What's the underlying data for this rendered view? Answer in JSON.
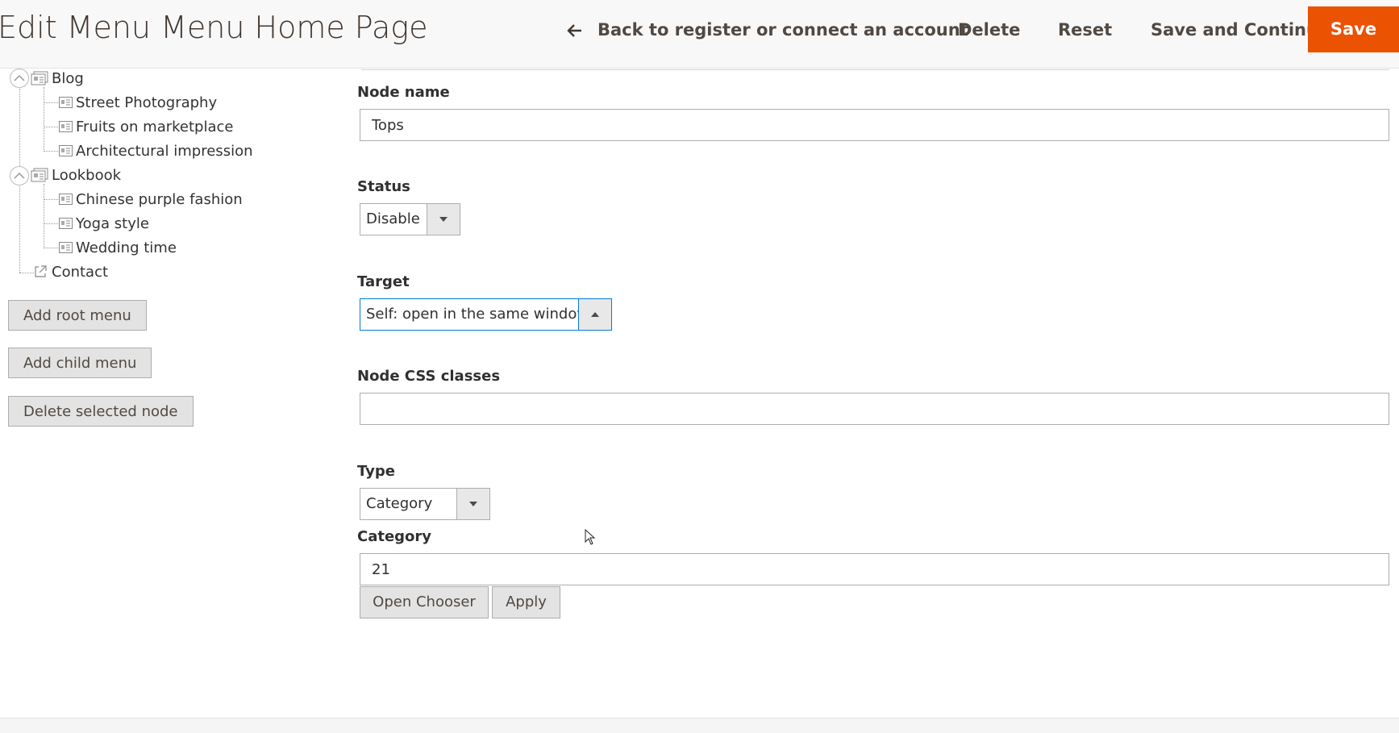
{
  "header": {
    "title": "Edit Menu Menu Home Page",
    "back_label": "Back to register or connect an account",
    "delete_label": "Delete",
    "reset_label": "Reset",
    "save_continue_label": "Save and Continue",
    "save_label": "Save"
  },
  "tree": {
    "blog": {
      "label": "Blog",
      "children": [
        "Street Photography",
        "Fruits on marketplace",
        "Architectural impression"
      ]
    },
    "lookbook": {
      "label": "Lookbook",
      "children": [
        "Chinese purple fashion",
        "Yoga style",
        "Wedding time"
      ]
    },
    "contact": {
      "label": "Contact"
    }
  },
  "sidebar_buttons": {
    "add_root": "Add root menu",
    "add_child": "Add child menu",
    "delete_node": "Delete selected node"
  },
  "form": {
    "node_name": {
      "label": "Node name",
      "value": "Tops"
    },
    "status": {
      "label": "Status",
      "value": "Disable"
    },
    "target": {
      "label": "Target",
      "value": "Self: open in the same window"
    },
    "css_classes": {
      "label": "Node CSS classes",
      "value": ""
    },
    "type": {
      "label": "Type",
      "value": "Category"
    },
    "category": {
      "label": "Category",
      "value": "21"
    },
    "open_chooser_label": "Open Chooser",
    "apply_label": "Apply"
  },
  "colors": {
    "accent": "#eb5202",
    "focus": "#007bdb"
  }
}
